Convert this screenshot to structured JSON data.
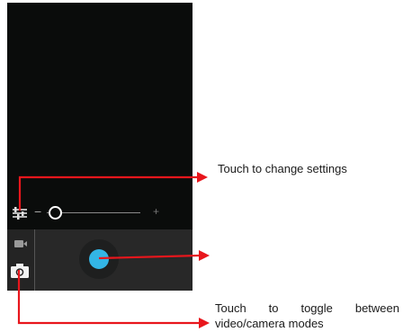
{
  "camera": {
    "zoom": {
      "minus_label": "−",
      "plus_label": "+",
      "level": 0.0
    },
    "icons": {
      "settings": "settings-sliders-icon",
      "video_mode": "video-camera-icon",
      "photo_mode": "photo-camera-icon",
      "shutter": "shutter-button"
    },
    "colors": {
      "shutter": "#33b5e5",
      "annotation": "#e8161c",
      "viewfinder": "#0a0c0b"
    }
  },
  "annotations": {
    "settings_callout": "Touch to change settings",
    "mode_toggle_callout": "Touch to toggle between video/camera modes"
  }
}
